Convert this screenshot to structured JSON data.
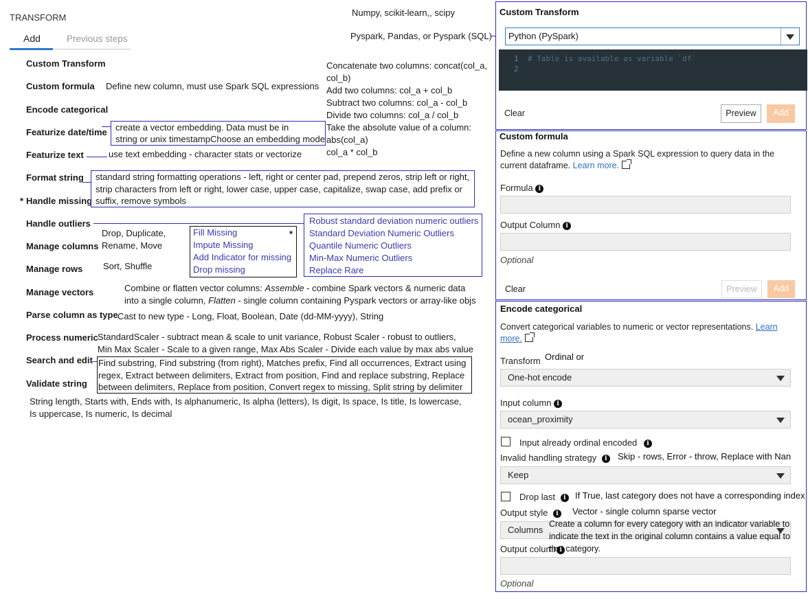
{
  "header": {
    "title": "TRANSFORM",
    "tab_add": "Add",
    "tab_previous": "Previous steps"
  },
  "top_notes": {
    "libs": "Numpy, scikit-learn,, scipy",
    "languages": "Pyspark, Pandas, or Pyspark (SQL)"
  },
  "transforms": [
    {
      "label": "Custom Transform",
      "note": ""
    },
    {
      "label": "Custom formula",
      "note": "Define new column, must use Spark SQL expressions"
    },
    {
      "label": "Encode categorical",
      "note": ""
    },
    {
      "label": "Featurize date/time",
      "note": ""
    },
    {
      "label": "Featurize text",
      "note": "use text embedding - character stats or vectorize"
    },
    {
      "label": "Format string",
      "note": ""
    },
    {
      "label": "Handle missing",
      "note": ""
    },
    {
      "label": "Handle outliers",
      "note": ""
    },
    {
      "label": "Manage columns",
      "note": ""
    },
    {
      "label": "Manage rows",
      "note": "Sort, Shuffle"
    },
    {
      "label": "Manage vectors",
      "note": ""
    },
    {
      "label": "Parse column as type",
      "note": "Cast to new type - Long, Float, Boolean, Date (dd-MM-yyyy), String"
    },
    {
      "label": "Process numeric",
      "note": ""
    },
    {
      "label": "Search and edit",
      "note": ""
    },
    {
      "label": "Validate string",
      "note": ""
    }
  ],
  "asterisks": {
    "handle_missing": "*",
    "missing_box": "*"
  },
  "formula_examples": [
    "Concatenate two columns: concat(col_a,",
    "col_b)",
    "Add two columns: col_a + col_b",
    "Subtract two columns: col_a - col_b",
    "Divide two columns: col_a / col_b",
    "Take the absolute value of a column:",
    "abs(col_a)",
    "col_a * col_b"
  ],
  "datetime_note": [
    "create a vector embedding. Data must be in",
    "string or unix timestampChoose an embedding mode"
  ],
  "format_string_note": [
    "standard string formatting operations - left, right or center pad, prepend zeros, strip left or right,",
    "strip characters from left or right, lower case, upper case, capitalize, swap case, add prefix or",
    "suffix, remove symbols"
  ],
  "manage_columns_note": [
    "Drop, Duplicate,",
    "Rename, Move"
  ],
  "missing_options": [
    "Fill Missing",
    "Impute Missing",
    "Add Indicator for missing",
    "Drop missing"
  ],
  "outlier_options": [
    "Robust standard deviation numeric outliers",
    "Standard Deviation Numeric Outliers",
    "Quantile Numeric Outliers",
    "Min-Max Numeric Outliers",
    "Replace Rare"
  ],
  "manage_vectors_note": {
    "prefix": "Combine or flatten vector columns: ",
    "assemble": "Assemble",
    "assemble_desc": " - combine Spark vectors & numeric data",
    "line2_prefix": "into a single column, ",
    "flatten": "Flatten",
    "flatten_desc": " - single column containing Pyspark vectors or array-like objs"
  },
  "process_numeric_note": [
    "StandardScaler - subtract mean & scale to unit variance, Robust Scaler - robust to outliers,",
    "Min Max Scaler - Scale to a given range, Max Abs Scaler - Divide each value by max abs value"
  ],
  "search_edit_note": [
    "Find substring, Find substring (from right), Matches prefix, Find all occurrences, Extract using",
    "regex, Extract between delimiters, Extract from position, Find and replace substring, Replace",
    "between delimiters, Replace from position, Convert regex to missing, Split string by delimiter"
  ],
  "validate_string_note": [
    "String length, Starts with, Ends with, Is alphanumeric, Is alpha (letters), Is digit, Is space, Is title, Is lowercase,",
    "Is uppercase, Is numeric, Is decimal"
  ],
  "panel_custom_transform": {
    "title": "Custom Transform",
    "language": "Python (PySpark)",
    "code_lines": [
      {
        "num": "1",
        "text": "# Table is available as variable `df`"
      },
      {
        "num": "2",
        "text": ""
      }
    ],
    "clear": "Clear",
    "preview": "Preview",
    "add": "Add"
  },
  "panel_custom_formula": {
    "title": "Custom formula",
    "desc_line1": "Define a new column using a Spark SQL expression to query data in the",
    "desc_line2": "current dataframe.",
    "learn_more": "Learn more.",
    "formula_label": "Formula",
    "output_label": "Output Column",
    "optional": "Optional",
    "clear": "Clear",
    "preview": "Preview",
    "add": "Add"
  },
  "panel_encode": {
    "title": "Encode categorical",
    "desc": "Convert categorical variables to numeric or vector representations.",
    "learn": "Learn",
    "more": "more.",
    "transform_label": "Transform",
    "transform_note": "Ordinal or",
    "transform_value": "One-hot encode",
    "input_label": "Input column",
    "input_value": "ocean_proximity",
    "ordinal_label": "Input already ordinal encoded",
    "invalid_label": "Invalid handling strategy",
    "invalid_note": "Skip - rows, Error - throw, Replace with Nan",
    "invalid_value": "Keep",
    "drop_last_label": "Drop last",
    "drop_last_note": "If True, last category does not have a corresponding index",
    "output_style_label": "Output style",
    "output_style_note": "Vector - single column sparse vector",
    "output_style_value": "Columns",
    "columns_note": [
      "Create a column for every category with an indicator variable to",
      "indicate the text in the original column contains a value equal to",
      "that category."
    ],
    "output_column_label": "Output column",
    "optional": "Optional"
  }
}
